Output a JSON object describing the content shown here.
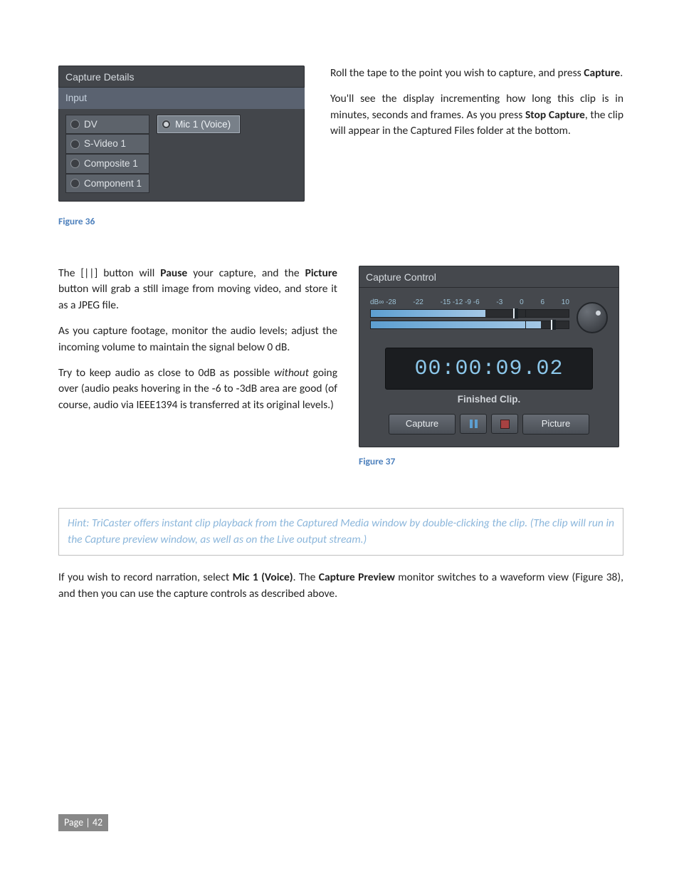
{
  "captureDetails": {
    "title": "Capture Details",
    "sectionLabel": "Input",
    "leftOptions": [
      "DV",
      "S-Video 1",
      "Composite 1",
      "Component 1"
    ],
    "rightOptions": [
      "Mic 1 (Voice)"
    ],
    "selectedRight": "Mic 1 (Voice)"
  },
  "figure36": "Figure 36",
  "right1_p1_a": "Roll the tape to the point you wish to capture, and press ",
  "right1_p1_b": "Capture",
  "right1_p1_c": ".",
  "right1_p2_a": "You'll see the display incrementing how long this clip is in minutes, seconds and frames. As you press ",
  "right1_p2_b": "Stop Capture",
  "right1_p2_c": ", the clip will appear in the Captured Files folder at the bottom.",
  "left2_p1_a": "The [||] button will ",
  "left2_p1_b": "Pause",
  "left2_p1_c": " your capture, and the ",
  "left2_p1_d": "Picture",
  "left2_p1_e": " button will grab a still image from moving video, and store it as a JPEG file.",
  "left2_p2": "As you capture footage, monitor the audio levels; adjust the incoming volume to maintain the signal below 0 dB.",
  "left2_p3_a": "Try to keep audio as close to 0dB as possible ",
  "left2_p3_b": "without",
  "left2_p3_c": " going over (audio peaks hovering in the ‑6 to ‑3dB area are good (of course, audio via IEEE1394 is transferred at its original levels.)",
  "captureControl": {
    "title": "Capture Control",
    "dbTicks": [
      "dB∞ -28",
      "-22",
      "-15 -12 -9 -6",
      "-3",
      "0",
      "6",
      "10"
    ],
    "meterFill": [
      "58%",
      "86%"
    ],
    "peak": [
      "72%",
      "91%"
    ],
    "timecode": "00:00:09.02",
    "status": "Finished Clip.",
    "captureBtn": "Capture",
    "pictureBtn": "Picture"
  },
  "figure37": "Figure 37",
  "hint": "Hint: TriCaster offers instant clip playback from the Captured Media window by double-clicking the clip. (The clip will run in the Capture preview window, as well as on the Live output stream.)",
  "last_a": "If you wish to record narration, select ",
  "last_b": "Mic 1 (Voice)",
  "last_c": ".  The ",
  "last_d": "Capture Preview",
  "last_e": " monitor switches to a waveform view (Figure 38), and then you can use the capture controls as described above.",
  "footer": "Page | 42"
}
